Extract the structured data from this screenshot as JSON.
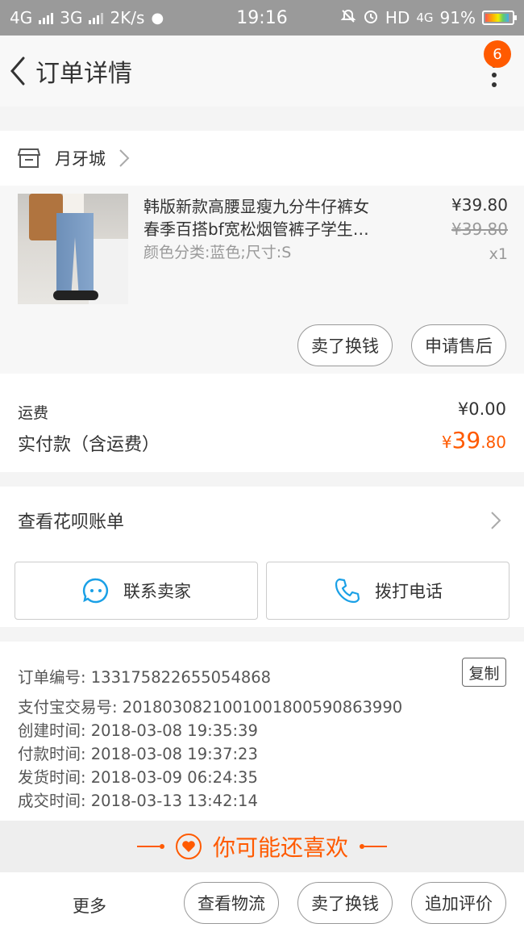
{
  "status_bar": {
    "network1": "4G",
    "network2": "3G",
    "speed": "2K/s",
    "time": "19:16",
    "hd": "HD",
    "network3": "4G",
    "battery": "91%",
    "battery_level": 0.91
  },
  "header": {
    "title": "订单详情",
    "badge": "6"
  },
  "shop": {
    "name": "月牙城"
  },
  "product": {
    "title_line1": "韩版新款高腰显瘦九分牛仔裤女",
    "title_line2": "春季百搭bf宽松烟管裤子学生…",
    "spec": "颜色分类:蓝色;尺寸:S",
    "price": "¥39.80",
    "original_price": "¥39.80",
    "quantity": "x1",
    "buttons": [
      "卖了换钱",
      "申请售后"
    ]
  },
  "fees": {
    "shipping_label": "运费",
    "shipping_value": "¥0.00",
    "paid_label": "实付款（含运费）",
    "paid_currency": "¥",
    "paid_int": "39",
    "paid_dec": ".80"
  },
  "bill": {
    "label": "查看花呗账单"
  },
  "contact": {
    "seller": "联系卖家",
    "phone": "拨打电话"
  },
  "order_info": {
    "lines": [
      "订单编号: 1331758226550548​68",
      "支付宝交易号: 2018030821001001800590863990",
      "创建时间: 2018-03-08 19:35:39",
      "付款时间: 2018-03-08 19:37:23",
      "发货时间: 2018-03-09 06:24:35",
      "成交时间: 2018-03-13 13:42:14"
    ],
    "copy": "复制"
  },
  "recommend": {
    "title": "你可能还喜欢"
  },
  "bottom_bar": {
    "more": "更多",
    "buttons": [
      "查看物流",
      "卖了换钱",
      "追加评价"
    ]
  },
  "colors": {
    "accent": "#ff5a00",
    "statusbar": "#9a9a9a"
  }
}
